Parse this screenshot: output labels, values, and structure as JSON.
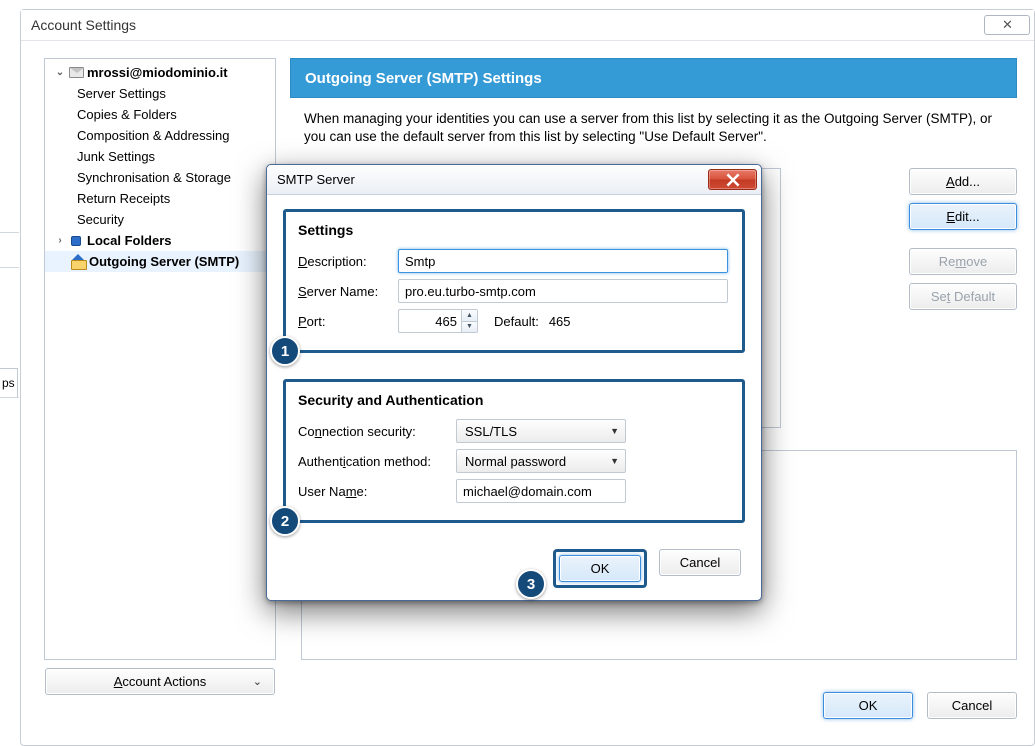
{
  "window": {
    "title": "Account Settings",
    "close_glyph": "✕"
  },
  "tree": {
    "account_email": "mrossi@miodominio.it",
    "items": {
      "server_settings": "Server Settings",
      "copies_folders": "Copies & Folders",
      "composition": "Composition & Addressing",
      "junk": "Junk Settings",
      "sync": "Synchronisation & Storage",
      "receipts": "Return Receipts",
      "security": "Security"
    },
    "local_folders": "Local Folders",
    "outgoing": "Outgoing Server (SMTP)"
  },
  "account_actions_label": "Account Actions",
  "right": {
    "header": "Outgoing Server (SMTP) Settings",
    "description": "When managing your identities you can use a server from this list by selecting it as the Outgoing Server (SMTP), or you can use the default server from this list by selecting \"Use Default Server\"."
  },
  "buttons": {
    "add": "Add...",
    "edit": "Edit...",
    "remove": "Remove",
    "set_default": "Set Default",
    "ok": "OK",
    "cancel": "Cancel"
  },
  "modal": {
    "title": "SMTP Server",
    "settings_title": "Settings",
    "labels": {
      "description": "Description:",
      "server_name": "Server Name:",
      "port": "Port:",
      "default": "Default:",
      "conn_sec": "Connection security:",
      "auth_method": "Authentication method:",
      "user_name": "User Name:"
    },
    "values": {
      "description": "Smtp",
      "server_name": "pro.eu.turbo-smtp.com",
      "port": "465",
      "default_port": "465",
      "conn_sec": "SSL/TLS",
      "auth_method": "Normal password",
      "user_name": "michael@domain.com"
    },
    "sec_title": "Security and Authentication",
    "ok": "OK",
    "cancel": "Cancel"
  },
  "steps": {
    "one": "1",
    "two": "2",
    "three": "3"
  },
  "misc": {
    "stray": "ps"
  }
}
